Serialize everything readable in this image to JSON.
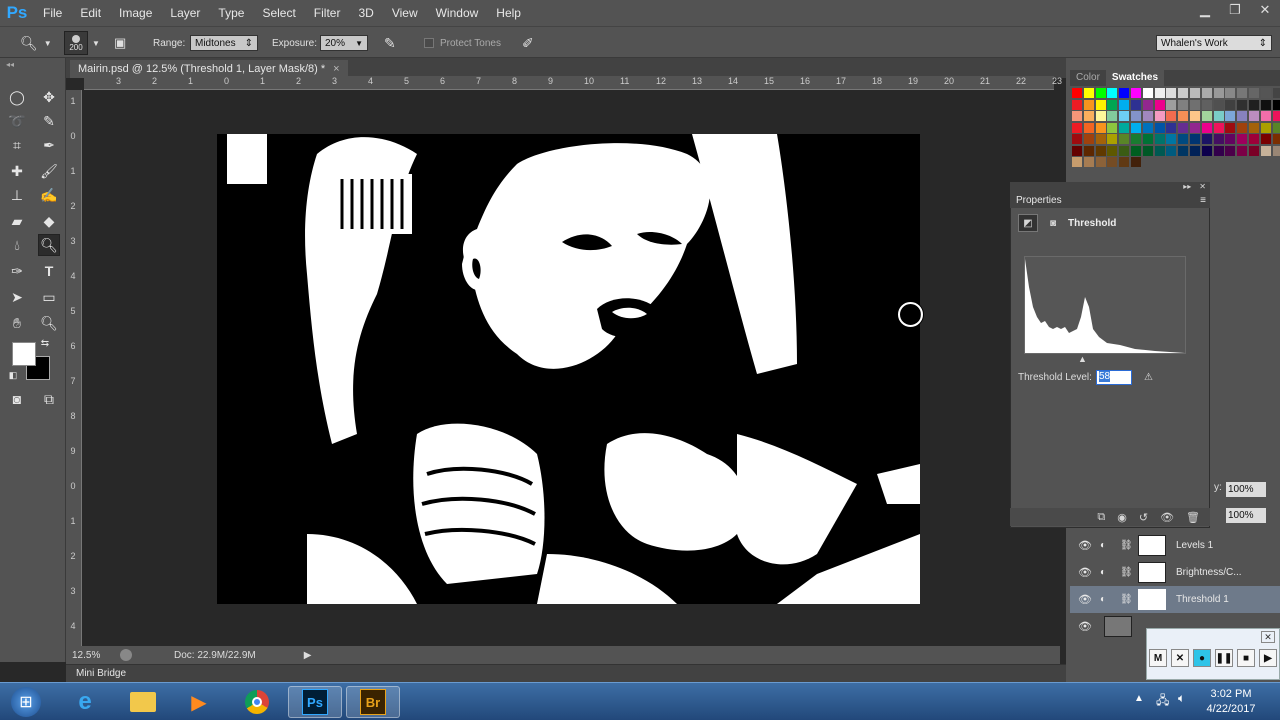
{
  "menubar": {
    "logo": "Ps",
    "items": [
      "File",
      "Edit",
      "Image",
      "Layer",
      "Type",
      "Select",
      "Filter",
      "3D",
      "View",
      "Window",
      "Help"
    ]
  },
  "options": {
    "brush_size": "200",
    "range_label": "Range:",
    "range_value": "Midtones",
    "exposure_label": "Exposure:",
    "exposure_value": "20%",
    "protect_tones": "Protect Tones",
    "workspace": "Whalen's Work"
  },
  "document": {
    "tab_title": "Mairin.psd @ 12.5% (Threshold 1, Layer Mask/8) *",
    "close": "×",
    "zoom": "12.5%",
    "doc_size": "Doc: 22.9M/22.9M"
  },
  "ruler_top": [
    "3",
    "2",
    "1",
    "0",
    "1",
    "2",
    "3",
    "4",
    "5",
    "6",
    "7",
    "8",
    "9",
    "10",
    "11",
    "12",
    "13",
    "14",
    "15",
    "16",
    "17",
    "18",
    "19",
    "20",
    "21",
    "22",
    "23"
  ],
  "ruler_left": [
    "1",
    "0",
    "1",
    "2",
    "3",
    "4",
    "5",
    "6",
    "7",
    "8",
    "9",
    "0",
    "1",
    "2",
    "3",
    "4"
  ],
  "mini_bridge": "Mini Bridge",
  "swatches": {
    "tabs": [
      "Color",
      "Swatches"
    ],
    "colors": [
      "#ff0000",
      "#ffff00",
      "#00ff00",
      "#00ffff",
      "#0000ff",
      "#ff00ff",
      "#ffffff",
      "#eeeeee",
      "#dddddd",
      "#cccccc",
      "#bbbbbb",
      "#aaaaaa",
      "#999999",
      "#888888",
      "#777777",
      "#666666",
      "#555555",
      "#444444",
      "#333333",
      "#ff2200",
      "#ee1c24",
      "#f7941d",
      "#fff200",
      "#00a651",
      "#00aeef",
      "#2e3192",
      "#92278f",
      "#ec008c",
      "#9e9e9e",
      "#808080",
      "#707070",
      "#606060",
      "#505050",
      "#404040",
      "#303030",
      "#202020",
      "#101010",
      "#000000",
      "#cccccc",
      "#888888",
      "#f69679",
      "#fbaf5d",
      "#fff79a",
      "#82ca9c",
      "#6dcff6",
      "#8393ca",
      "#a187be",
      "#f49ac1",
      "#f26c4f",
      "#f68e56",
      "#fdc689",
      "#a3d39c",
      "#7accc8",
      "#7da7d9",
      "#8882be",
      "#bc8dbf",
      "#f06ea9",
      "#ed145b",
      "#f7941d",
      "#ffff00",
      "#ed1c24",
      "#f26522",
      "#f7941d",
      "#8dc63f",
      "#00a99d",
      "#00aeef",
      "#0072bc",
      "#0054a6",
      "#2e3192",
      "#662d91",
      "#92278f",
      "#ec008c",
      "#ed145b",
      "#9e0b0f",
      "#a0410d",
      "#a36209",
      "#aba000",
      "#598527",
      "#197b30",
      "#007236",
      "#9e0b0f",
      "#a0410d",
      "#a36209",
      "#aba000",
      "#598527",
      "#197b30",
      "#007236",
      "#00746b",
      "#0076a3",
      "#004a80",
      "#003471",
      "#1b1464",
      "#440e62",
      "#630460",
      "#9e005d",
      "#9e0039",
      "#790000",
      "#7b2e00",
      "#7d4900",
      "#827b00",
      "#630000",
      "#5d2700",
      "#603900",
      "#5e5800",
      "#3b5c14",
      "#005e20",
      "#005826",
      "#005952",
      "#005b7f",
      "#003663",
      "#002157",
      "#0d004c",
      "#32004b",
      "#4b0049",
      "#7b0046",
      "#7a0026",
      "#c7b299",
      "#998675",
      "#736357",
      "#534741",
      "#c69c6d",
      "#a67c52",
      "#8c6239",
      "#754c24",
      "#603913",
      "#42210b"
    ]
  },
  "properties": {
    "title": "Properties",
    "adjustment": "Threshold",
    "level_label": "Threshold Level:",
    "level_value": "58"
  },
  "layers": {
    "opacity": "100%",
    "fill": "100%",
    "items": [
      {
        "name": "Levels 1"
      },
      {
        "name": "Brightness/C..."
      },
      {
        "name": "Threshold 1"
      }
    ]
  },
  "player": {
    "m": "M",
    "x": "✕"
  },
  "clock": {
    "time": "3:02 PM",
    "date": "4/22/2017"
  }
}
